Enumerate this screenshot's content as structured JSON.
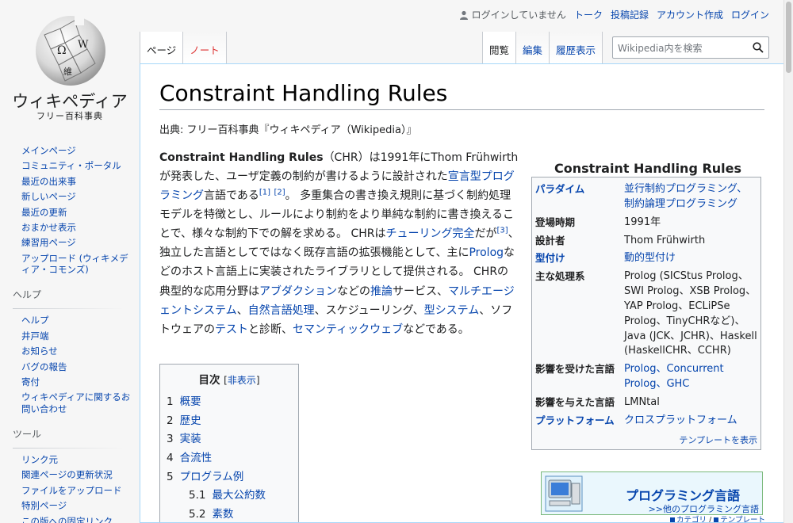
{
  "logo": {
    "wordmark": "ウィキペディア",
    "tagline": "フリー百科事典",
    "globe_letters": [
      "Ω",
      "W",
      "維"
    ]
  },
  "personal": {
    "not_logged_in": "ログインしていません",
    "links": [
      "トーク",
      "投稿記録",
      "アカウント作成",
      "ログイン"
    ]
  },
  "tabs": {
    "left": [
      "ページ",
      "ノート"
    ],
    "right": [
      "閲覧",
      "編集",
      "履歴表示"
    ]
  },
  "search": {
    "placeholder": "Wikipedia内を検索"
  },
  "sidebar": {
    "nav": [
      "メインページ",
      "コミュニティ・ポータル",
      "最近の出来事",
      "新しいページ",
      "最近の更新",
      "おまかせ表示",
      "練習用ページ",
      "アップロード (ウィキメディア・コモンズ)"
    ],
    "help_heading": "ヘルプ",
    "help": [
      "ヘルプ",
      "井戸端",
      "お知らせ",
      "バグの報告",
      "寄付",
      "ウィキペディアに関するお問い合わせ"
    ],
    "tools_heading": "ツール",
    "tools": [
      "リンク元",
      "関連ページの更新状況",
      "ファイルをアップロード",
      "特別ページ",
      "この版への固定リンク"
    ]
  },
  "article": {
    "title": "Constraint Handling Rules",
    "sitesub": "出典: フリー百科事典『ウィキペディア（Wikipedia）』",
    "lead": {
      "b": "Constraint Handling Rules",
      "t1": "（CHR）は1991年にThom Frühwirthが発表した、ユーザ定義の制約が書けるように設計された",
      "l1": "宣言型プログラミング",
      "t2": "言語である",
      "r1": "[1]",
      "r2": "[2]",
      "t3": "。 多重集合の書き換え規則に基づく制約処理モデルを特徴とし、ルールにより制約をより単純な制約に書き換えることで、様々な制約下での解を求める。 CHRは",
      "l2": "チューリング完全",
      "t4": "だが",
      "r3": "[3]",
      "t5": "、 独立した言語としてではなく既存言語の拡張機能として、主に",
      "l3": "Prolog",
      "t6": "などのホスト言語上に実装されたライブラリとして提供される。 CHRの典型的な応用分野は",
      "l4": "アブダクション",
      "t7": "などの",
      "l5": "推論",
      "t8": "サービス、",
      "l6": "マルチエージェントシステム",
      "t9": "、",
      "l7": "自然言語処理",
      "t10": "、スケジューリング、",
      "l8": "型システム",
      "t11": "、ソフトウェアの",
      "l9": "テスト",
      "t12": "と診断、",
      "l10": "セマンティックウェブ",
      "t13": "などである。"
    }
  },
  "toc": {
    "title": "目次",
    "toggle_open": "[",
    "toggle": "非表示",
    "toggle_close": "]",
    "items": [
      {
        "num": "1",
        "label": "概要"
      },
      {
        "num": "2",
        "label": "歴史"
      },
      {
        "num": "3",
        "label": "実装"
      },
      {
        "num": "4",
        "label": "合流性"
      },
      {
        "num": "5",
        "label": "プログラム例"
      }
    ],
    "sub": [
      {
        "num": "5.1",
        "label": "最大公約数"
      },
      {
        "num": "5.2",
        "label": "素数"
      }
    ]
  },
  "infobox": {
    "title": "Constraint Handling Rules",
    "rows": [
      {
        "k": "パラダイム",
        "k_link": true,
        "v": "並行制約プログラミング、制約論理プログラミング",
        "v_link": true
      },
      {
        "k": "登場時期",
        "k_link": false,
        "v": "1991年",
        "v_link": false
      },
      {
        "k": "設計者",
        "k_link": false,
        "v": "Thom Frühwirth",
        "v_link": false
      },
      {
        "k": "型付け",
        "k_link": true,
        "v": "動的型付け",
        "v_link": true
      },
      {
        "k": "主な処理系",
        "k_link": false,
        "v": "Prolog (SICStus Prolog、SWI Prolog、XSB Prolog、YAP Prolog、ECLiPSe Prolog、TinyCHRなど)、Java (JCK、JCHR)、Haskell (HaskellCHR、CCHR)",
        "v_link": false
      },
      {
        "k": "影響を受けた言語",
        "k_link": false,
        "v": "Prolog、Concurrent Prolog、GHC",
        "v_link": true
      },
      {
        "k": "影響を与えた言語",
        "k_link": false,
        "v": "LMNtal",
        "v_link": false
      },
      {
        "k": "プラットフォーム",
        "k_link": true,
        "v": "クロスプラットフォーム",
        "v_link": true
      }
    ],
    "footer": "テンプレートを表示"
  },
  "navbox": {
    "title": "プログラミング言語",
    "sub": ">>他のプログラミング言語",
    "cat": "カテゴリ",
    "sep": " / ",
    "tmpl": "テンプレート"
  },
  "colors": {
    "link": "#0645ad",
    "border": "#a2a9b1",
    "content_border": "#a7d7f9"
  }
}
